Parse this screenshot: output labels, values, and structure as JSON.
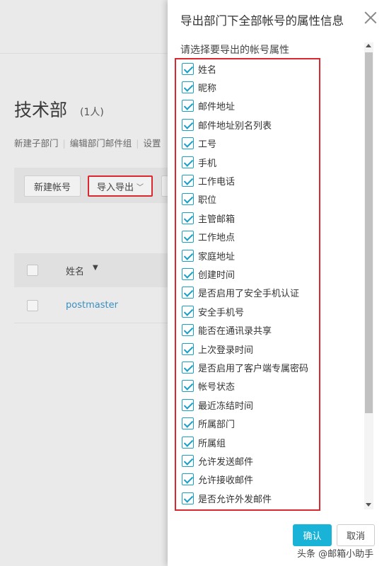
{
  "background": {
    "department_title": "技术部",
    "member_count": "(1人)",
    "links": [
      "新建子部门",
      "编辑部门邮件组",
      "设置"
    ],
    "toolbar": {
      "new_account": "新建帐号",
      "import_export": "导入导出"
    },
    "table": {
      "col_name": "姓名",
      "rows": [
        {
          "name": "postmaster"
        }
      ]
    }
  },
  "dialog": {
    "title": "导出部门下全部帐号的属性信息",
    "subtitle": "请选择要导出的帐号属性",
    "attributes": [
      {
        "label": "姓名",
        "checked": true
      },
      {
        "label": "昵称",
        "checked": true
      },
      {
        "label": "邮件地址",
        "checked": true
      },
      {
        "label": "邮件地址别名列表",
        "checked": true
      },
      {
        "label": "工号",
        "checked": true
      },
      {
        "label": "手机",
        "checked": true
      },
      {
        "label": "工作电话",
        "checked": true
      },
      {
        "label": "职位",
        "checked": true
      },
      {
        "label": "主管邮箱",
        "checked": true
      },
      {
        "label": "工作地点",
        "checked": true
      },
      {
        "label": "家庭地址",
        "checked": true
      },
      {
        "label": "创建时间",
        "checked": true
      },
      {
        "label": "是否启用了安全手机认证",
        "checked": true
      },
      {
        "label": "安全手机号",
        "checked": true
      },
      {
        "label": "能否在通讯录共享",
        "checked": true
      },
      {
        "label": "上次登录时间",
        "checked": true
      },
      {
        "label": "是否启用了客户端专属密码",
        "checked": true
      },
      {
        "label": "帐号状态",
        "checked": true
      },
      {
        "label": "最近冻结时间",
        "checked": true
      },
      {
        "label": "所属部门",
        "checked": true
      },
      {
        "label": "所属组",
        "checked": true
      },
      {
        "label": "允许发送邮件",
        "checked": true
      },
      {
        "label": "允许接收邮件",
        "checked": true
      },
      {
        "label": "是否允许外发邮件",
        "checked": true
      }
    ],
    "confirm_label": "确认",
    "cancel_label": "取消"
  },
  "watermark": "头条 @邮箱小助手",
  "colors": {
    "accent": "#1ab3d8",
    "highlight_border": "#d9282f",
    "link": "#3a8fc2"
  }
}
